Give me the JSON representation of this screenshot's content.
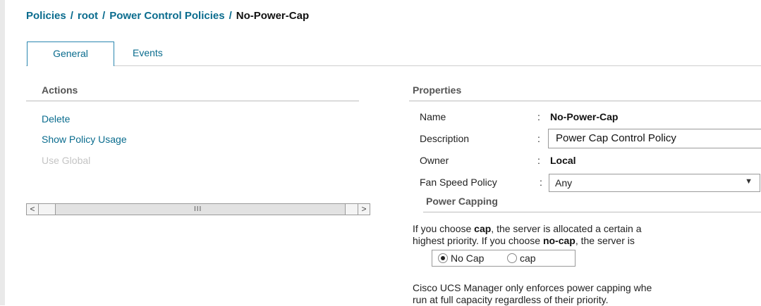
{
  "breadcrumb": {
    "items": [
      "Policies",
      "root",
      "Power Control Policies"
    ],
    "separator": "/",
    "current": "No-Power-Cap"
  },
  "tabs": [
    {
      "label": "General",
      "active": true
    },
    {
      "label": "Events",
      "active": false
    }
  ],
  "actions": {
    "title": "Actions",
    "items": [
      {
        "label": "Delete",
        "enabled": true
      },
      {
        "label": "Show Policy Usage",
        "enabled": true
      },
      {
        "label": "Use Global",
        "enabled": false
      }
    ]
  },
  "scrollbar": {
    "left_arrow": "<",
    "right_arrow": ">",
    "grip": "III"
  },
  "properties": {
    "title": "Properties",
    "colon": ":",
    "name_label": "Name",
    "name_value": "No-Power-Cap",
    "description_label": "Description",
    "description_value": "Power Cap Control Policy",
    "owner_label": "Owner",
    "owner_value": "Local",
    "fan_label": "Fan Speed Policy",
    "fan_value": "Any"
  },
  "power_capping": {
    "title": "Power Capping",
    "para1_prefix": "If you choose ",
    "para1_cap": "cap",
    "para1_suffix": ", the server is allocated a certain a",
    "para2_prefix": "highest priority. If you choose ",
    "para2_nocap": "no-cap",
    "para2_suffix": ", the server is",
    "options": [
      {
        "label": "No Cap",
        "selected": true
      },
      {
        "label": "cap",
        "selected": false
      }
    ],
    "note_line1": "Cisco UCS Manager only enforces power capping whe",
    "note_line2": "run at full capacity regardless of their priority."
  },
  "colors": {
    "link": "#0a6c8e",
    "tab_border": "#2a86b0",
    "disabled": "#c4c4c4"
  }
}
